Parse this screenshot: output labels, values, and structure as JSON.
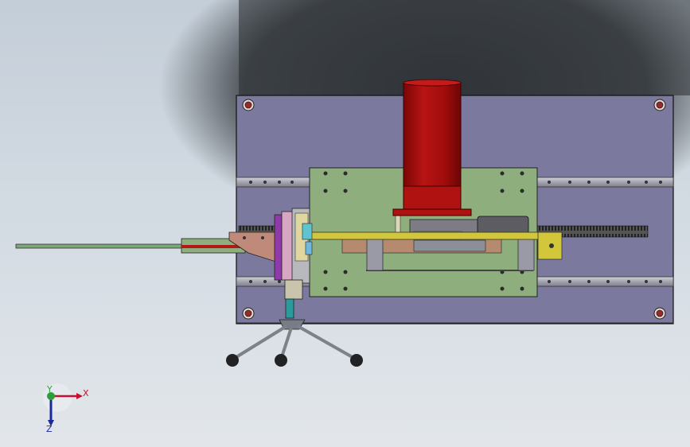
{
  "triad": {
    "x_label": "X",
    "y_label": "Y",
    "z_label": "Z",
    "x_color": "#c8102e",
    "y_color": "#2e9e3a",
    "z_color": "#1a2a9a"
  },
  "colors": {
    "base_plate": "#7b7a9e",
    "carriage_plate": "#8fae7d",
    "motor": "#a90f0f",
    "rail": "#a8a8b4",
    "rack": "#4a4a4a",
    "yellow_bar": "#d2c63a",
    "tripod": "#8a8f98"
  },
  "icons": [
    "coordinate-triad-icon",
    "bolt-icon",
    "tripod-stand-icon"
  ]
}
